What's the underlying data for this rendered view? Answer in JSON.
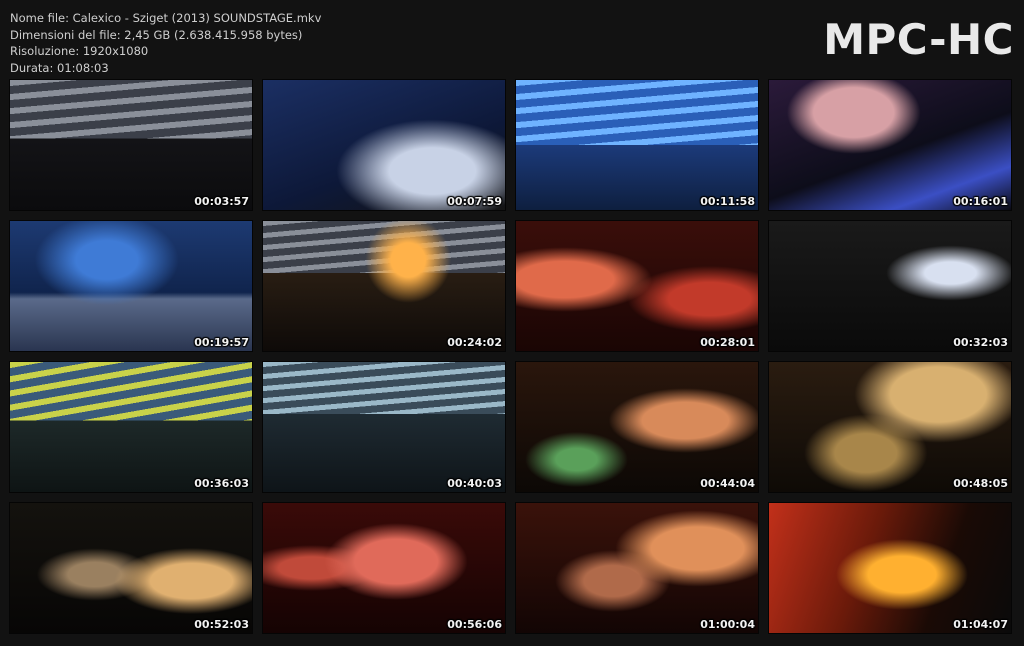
{
  "file_info": {
    "name": "Nome file: Calexico - Sziget (2013) SOUNDSTAGE.mkv",
    "size": "Dimensioni del file: 2,45 GB (2.638.415.958 bytes)",
    "resolution": "Risoluzione: 1920x1080",
    "duration": "Durata: 01:08:03"
  },
  "brand": "MPC-HC",
  "thumbnails": [
    {
      "timestamp": "00:03:57",
      "scene": "stage-stripes-gray"
    },
    {
      "timestamp": "00:07:59",
      "scene": "drummer-blue"
    },
    {
      "timestamp": "00:11:58",
      "scene": "stage-stripes-blue"
    },
    {
      "timestamp": "00:16:01",
      "scene": "keyboard-hand"
    },
    {
      "timestamp": "00:19:57",
      "scene": "crowd-wide"
    },
    {
      "timestamp": "00:24:02",
      "scene": "stage-stripes-orange"
    },
    {
      "timestamp": "00:28:01",
      "scene": "singer-red"
    },
    {
      "timestamp": "00:32:03",
      "scene": "drummer-dark"
    },
    {
      "timestamp": "00:36:03",
      "scene": "stage-stripes-yellow"
    },
    {
      "timestamp": "00:40:03",
      "scene": "stage-stripes-teal"
    },
    {
      "timestamp": "00:44:04",
      "scene": "singer-mics"
    },
    {
      "timestamp": "00:48:05",
      "scene": "cymbals"
    },
    {
      "timestamp": "00:52:03",
      "scene": "faces-dark"
    },
    {
      "timestamp": "00:56:06",
      "scene": "singer-red-close"
    },
    {
      "timestamp": "01:00:04",
      "scene": "singer-mics-red"
    },
    {
      "timestamp": "01:04:07",
      "scene": "trumpet-orange"
    }
  ]
}
